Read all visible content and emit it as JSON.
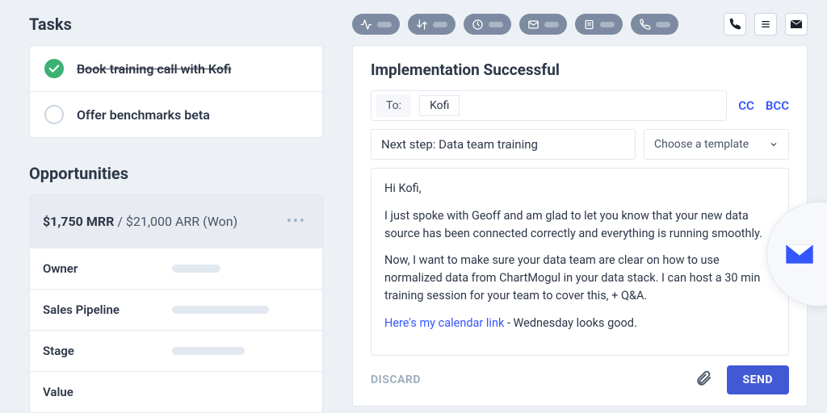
{
  "left": {
    "tasks_title": "Tasks",
    "tasks": [
      {
        "label": "Book training call with Kofi",
        "done": true
      },
      {
        "label": "Offer benchmarks beta",
        "done": false
      }
    ],
    "opportunities_title": "Opportunities",
    "opp_header": {
      "mrr": "$1,750 MRR",
      "arr": "/ $21,000 ARR (Won)"
    },
    "opp_fields": [
      "Owner",
      "Sales Pipeline",
      "Stage",
      "Value"
    ]
  },
  "toolbar": {
    "pills": [
      "activity",
      "sort",
      "history",
      "email",
      "note",
      "call"
    ],
    "square_buttons": [
      "phone",
      "list",
      "mail"
    ]
  },
  "email": {
    "title": "Implementation Successful",
    "to_label": "To:",
    "to_chip": "Kofi",
    "cc": "CC",
    "bcc": "BCC",
    "subject": "Next step: Data team training",
    "template_placeholder": "Choose a template",
    "body": {
      "greeting": "Hi Kofi,",
      "p1": "I just spoke with Geoff and am glad to let you know that your new data source has been connected correctly and everything is running smoothly.",
      "p2": "Now, I want to make sure your data team are clear on how to use normalized data from ChartMogul in your data stack. I can host a 30 min training session for your team to cover this, + Q&A.",
      "link_text": "Here's my calendar link",
      "p3_tail": " - Wednesday looks good."
    },
    "discard": "DISCARD",
    "send": "SEND"
  }
}
